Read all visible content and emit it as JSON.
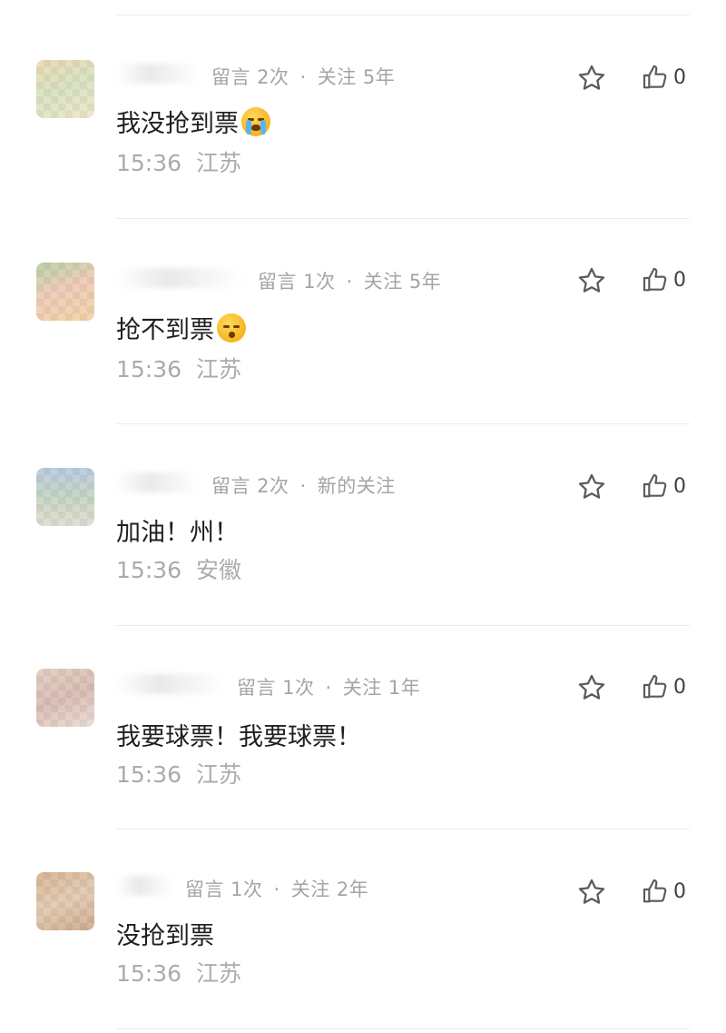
{
  "comments": [
    {
      "meta": "留言 2次 · 关注 5年",
      "meta_parts": [
        "留言 2次",
        "关注 5年"
      ],
      "content": "我没抢到票",
      "emoji": "crying-face-emoji",
      "time": "15:36",
      "location": "江苏",
      "like_count": "0",
      "avatar_color": "#c9a46a"
    },
    {
      "meta_parts": [
        "留言 1次",
        "关注 5年"
      ],
      "content": "抢不到票",
      "emoji": "kissing-face-emoji",
      "time": "15:36",
      "location": "江苏",
      "like_count": "0",
      "avatar_color": "#e08a5a"
    },
    {
      "meta_parts": [
        "留言 2次",
        "新的关注"
      ],
      "content": "加油！州！",
      "emoji": "",
      "time": "15:36",
      "location": "安徽",
      "like_count": "0",
      "avatar_color": "#6f8fb0"
    },
    {
      "meta_parts": [
        "留言 1次",
        "关注 1年"
      ],
      "content": "我要球票！我要球票！",
      "emoji": "",
      "time": "15:36",
      "location": "江苏",
      "like_count": "0",
      "avatar_color": "#b58c7a"
    },
    {
      "meta_parts": [
        "留言 1次",
        "关注 2年"
      ],
      "content": "没抢到票",
      "emoji": "",
      "time": "15:36",
      "location": "江苏",
      "like_count": "0",
      "avatar_color": "#b8763c"
    }
  ],
  "icons": {
    "star": "star-icon",
    "like": "thumbs-up-icon"
  },
  "colors": {
    "meta_text": "#a4a4a4",
    "content_text": "#1f1f1f",
    "icon_stroke": "#5a5a5a",
    "divider": "#ececec"
  }
}
